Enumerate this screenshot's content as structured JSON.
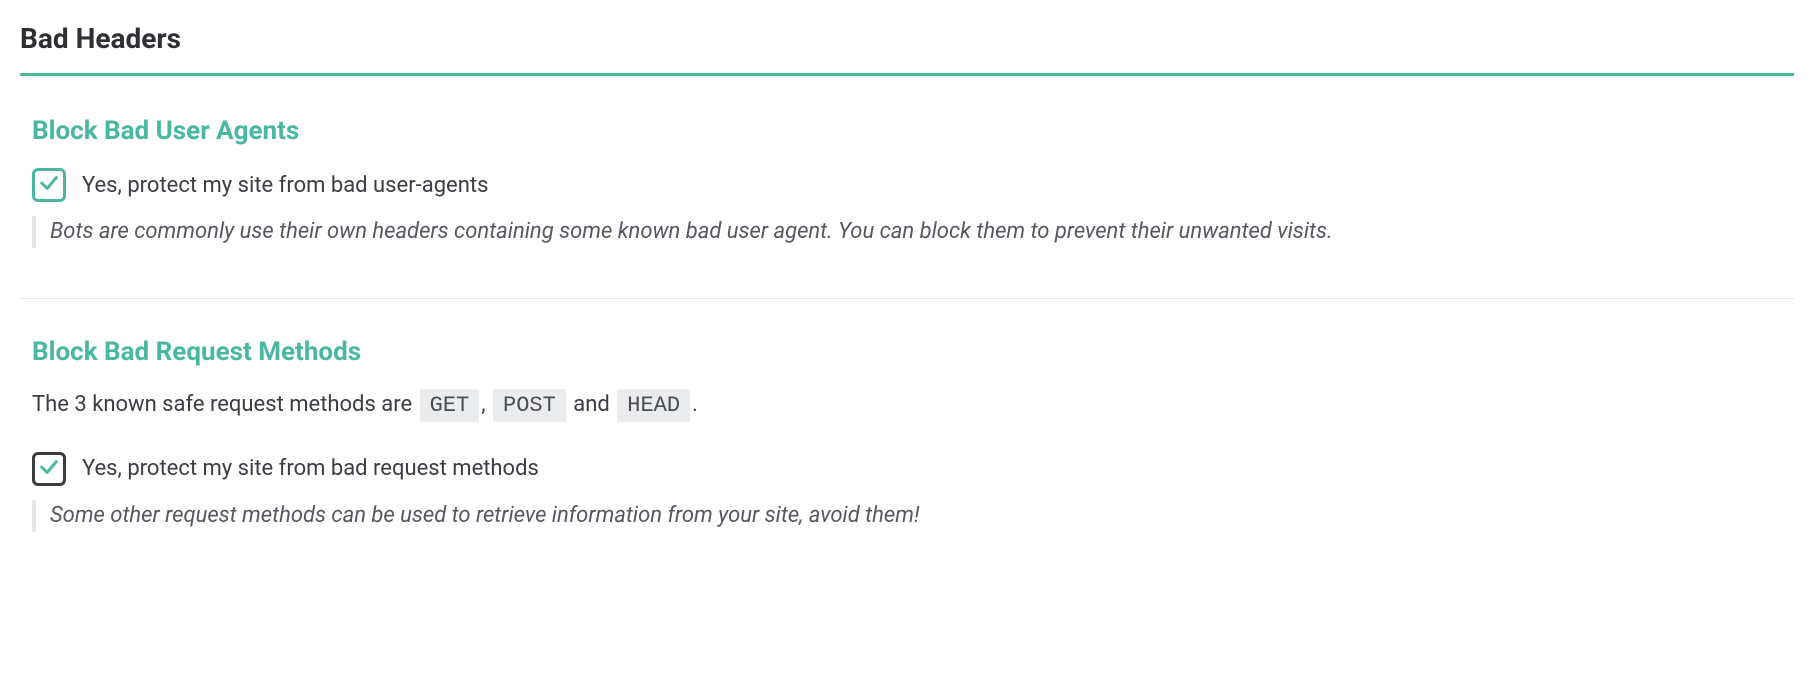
{
  "panel": {
    "title": "Bad Headers"
  },
  "sections": {
    "userAgents": {
      "title": "Block Bad User Agents",
      "checkbox_label": "Yes, protect my site from bad user-agents",
      "hint": "Bots are commonly use their own headers containing some known bad user agent. You can block them to prevent their unwanted visits."
    },
    "requestMethods": {
      "title": "Block Bad Request Methods",
      "intro_prefix": "The 3 known safe request methods are ",
      "chip_get": "GET",
      "sep_comma": ", ",
      "chip_post": "POST",
      "sep_and": " and ",
      "chip_head": "HEAD",
      "intro_suffix": ".",
      "checkbox_label": "Yes, protect my site from bad request methods",
      "hint": "Some other request methods can be used to retrieve information from your site, avoid them!"
    }
  }
}
